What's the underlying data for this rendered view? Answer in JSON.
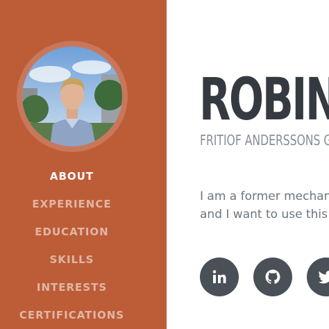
{
  "sidebar": {
    "nav": [
      {
        "label": "ABOUT",
        "active": true
      },
      {
        "label": "EXPERIENCE",
        "active": false
      },
      {
        "label": "EDUCATION",
        "active": false
      },
      {
        "label": "SKILLS",
        "active": false
      },
      {
        "label": "INTERESTS",
        "active": false
      },
      {
        "label": "CERTIFICATIONS",
        "active": false
      }
    ]
  },
  "main": {
    "name": "ROBIN",
    "address": "FRITIOF ANDERSSONS GATA",
    "lead_lines": [
      "I am a former mechan",
      "and I want to use this"
    ],
    "social_icons": [
      "linkedin-icon",
      "github-icon",
      "twitter-icon"
    ]
  },
  "colors": {
    "sidebar_bg": "#bd5d38",
    "heading": "#343a40",
    "subtext": "#868e96",
    "social_bg": "#495057"
  }
}
